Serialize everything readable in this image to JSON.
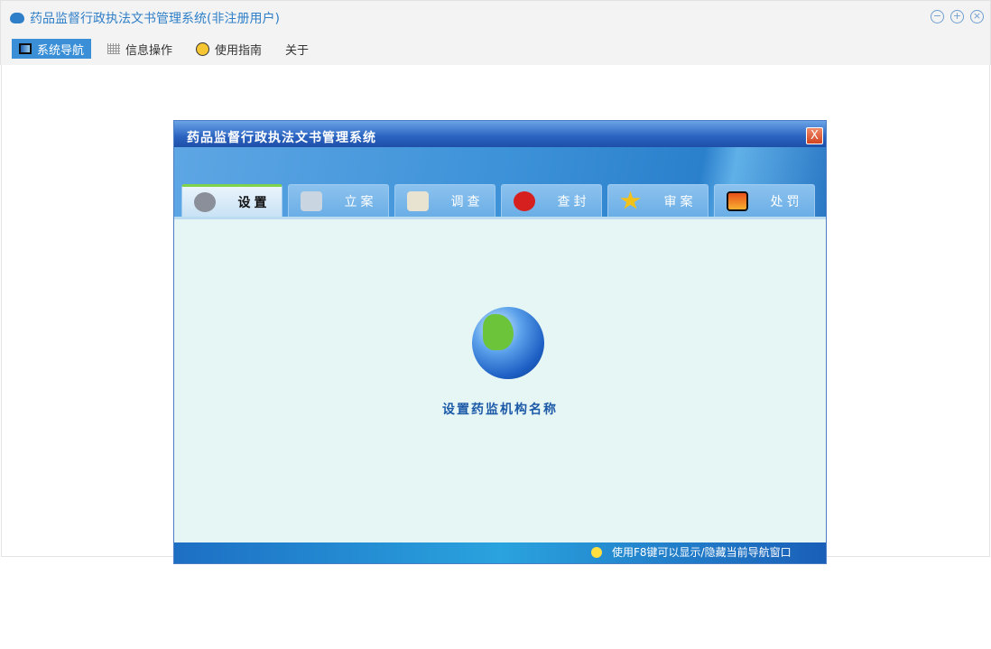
{
  "window": {
    "title": "药品监督行政执法文书管理系统(非注册用户)",
    "controls": [
      "minimize",
      "restore",
      "close"
    ]
  },
  "menu": [
    {
      "label": "系统导航",
      "icon": "window-icon",
      "active": true
    },
    {
      "label": "信息操作",
      "icon": "grid-icon"
    },
    {
      "label": "使用指南",
      "icon": "help-icon"
    },
    {
      "label": "关于"
    }
  ],
  "dialog": {
    "title": "药品监督行政执法文书管理系统",
    "tabs": [
      {
        "label": "设置",
        "icon": "gear-icon",
        "color": "#8a8f99"
      },
      {
        "label": "立案",
        "icon": "monitor-icon",
        "color": "#c9d6e2"
      },
      {
        "label": "调查",
        "icon": "book-icon",
        "color": "#e8e2d0"
      },
      {
        "label": "查封",
        "icon": "stop-icon",
        "color": "#d62020"
      },
      {
        "label": "审案",
        "icon": "star-icon",
        "color": "#f2c21a"
      },
      {
        "label": "处罚",
        "icon": "display-icon",
        "color": "#e8501a"
      }
    ],
    "content_label": "设置药监机构名称",
    "footer": "使用F8键可以显示/隐藏当前导航窗口"
  }
}
